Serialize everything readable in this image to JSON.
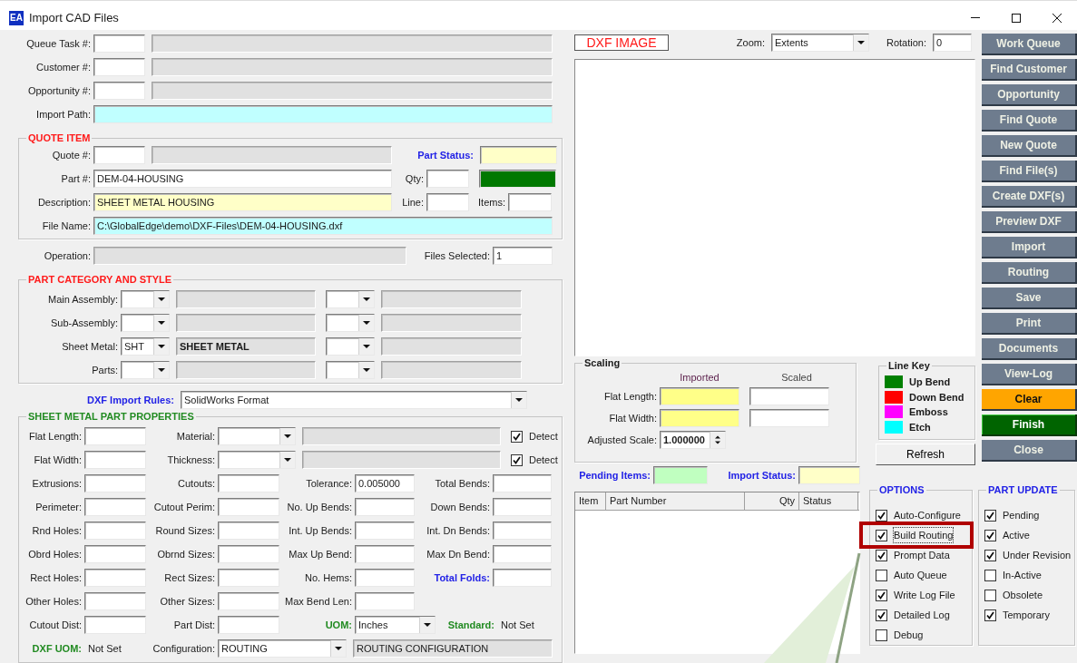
{
  "window": {
    "title": "Import CAD Files",
    "app_badge": "EA"
  },
  "lookups": [
    {
      "label": "Queue Task #:"
    },
    {
      "label": "Customer #:"
    },
    {
      "label": "Opportunity #:"
    }
  ],
  "import_path": {
    "label": "Import Path:"
  },
  "quote_item": {
    "title": "QUOTE ITEM",
    "quote_label": "Quote #:",
    "part_status_label": "Part Status:",
    "part_label": "Part #:",
    "part_number": "DEM-04-HOUSING",
    "qty_label": "Qty:",
    "description_label": "Description:",
    "description": "SHEET METAL HOUSING",
    "line_label": "Line:",
    "items_label": "Items:",
    "file_name_label": "File Name:",
    "file_name": "C:\\GlobalEdge\\demo\\DXF-Files\\DEM-04-HOUSING.dxf"
  },
  "operation": {
    "label": "Operation:",
    "files_selected_label": "Files Selected:",
    "files_selected": "1"
  },
  "part_category": {
    "title": "PART CATEGORY AND STYLE",
    "rows": [
      {
        "label": "Main Assembly:"
      },
      {
        "label": "Sub-Assembly:"
      },
      {
        "label": "Sheet Metal:",
        "code": "SHT",
        "description": "SHEET METAL"
      },
      {
        "label": "Parts:"
      }
    ]
  },
  "import_rules": {
    "label": "DXF Import Rules:",
    "value": "SolidWorks Format"
  },
  "sheet_metal": {
    "title": "SHEET METAL PART PROPERTIES",
    "rows": [
      [
        {
          "kind": "label",
          "text": "Flat Length:"
        },
        {
          "kind": "text"
        },
        {
          "kind": "label",
          "text": "Material:"
        },
        {
          "kind": "combo"
        },
        {
          "kind": "readonly"
        },
        {
          "kind": "check",
          "text": "Detect",
          "checked": true
        }
      ],
      [
        {
          "kind": "label",
          "text": "Flat Width:"
        },
        {
          "kind": "text"
        },
        {
          "kind": "label",
          "text": "Thickness:"
        },
        {
          "kind": "combo"
        },
        {
          "kind": "readonly"
        },
        {
          "kind": "check",
          "text": "Detect",
          "checked": true
        }
      ],
      [
        {
          "kind": "label",
          "text": "Extrusions:"
        },
        {
          "kind": "text"
        },
        {
          "kind": "label",
          "text": "Cutouts:"
        },
        {
          "kind": "text"
        },
        {
          "kind": "label",
          "text": "Tolerance:"
        },
        {
          "kind": "text",
          "value": "0.005000"
        },
        {
          "kind": "label",
          "text": "Total Bends:"
        },
        {
          "kind": "text"
        }
      ],
      [
        {
          "kind": "label",
          "text": "Perimeter:"
        },
        {
          "kind": "text"
        },
        {
          "kind": "label",
          "text": "Cutout Perim:"
        },
        {
          "kind": "text"
        },
        {
          "kind": "label",
          "text": "No. Up Bends:"
        },
        {
          "kind": "text"
        },
        {
          "kind": "label",
          "text": "Down Bends:"
        },
        {
          "kind": "text"
        }
      ],
      [
        {
          "kind": "label",
          "text": "Rnd Holes:"
        },
        {
          "kind": "text"
        },
        {
          "kind": "label",
          "text": "Round Sizes:"
        },
        {
          "kind": "text"
        },
        {
          "kind": "label",
          "text": "Int. Up Bends:"
        },
        {
          "kind": "text"
        },
        {
          "kind": "label",
          "text": "Int. Dn Bends:"
        },
        {
          "kind": "text"
        }
      ],
      [
        {
          "kind": "label",
          "text": "Obrd Holes:"
        },
        {
          "kind": "text"
        },
        {
          "kind": "label",
          "text": "Obrnd Sizes:"
        },
        {
          "kind": "text"
        },
        {
          "kind": "label",
          "text": "Max Up Bend:"
        },
        {
          "kind": "text"
        },
        {
          "kind": "label",
          "text": "Max Dn Bend:"
        },
        {
          "kind": "text"
        }
      ],
      [
        {
          "kind": "label",
          "text": "Rect Holes:"
        },
        {
          "kind": "text"
        },
        {
          "kind": "label",
          "text": "Rect Sizes:"
        },
        {
          "kind": "text"
        },
        {
          "kind": "label",
          "text": "No. Hems:"
        },
        {
          "kind": "text"
        },
        {
          "kind": "label",
          "text": "Total Folds:",
          "color": "#2222e6"
        },
        {
          "kind": "text"
        }
      ],
      [
        {
          "kind": "label",
          "text": "Other Holes:"
        },
        {
          "kind": "text"
        },
        {
          "kind": "label",
          "text": "Other Sizes:"
        },
        {
          "kind": "text"
        },
        {
          "kind": "label",
          "text": "Max Bend Len:"
        },
        {
          "kind": "text"
        }
      ],
      [
        {
          "kind": "label",
          "text": "Cutout Dist:"
        },
        {
          "kind": "text"
        },
        {
          "kind": "label",
          "text": "Part Dist:"
        },
        {
          "kind": "text"
        },
        {
          "kind": "label",
          "text": "UOM:",
          "color": "#228b22"
        },
        {
          "kind": "combo",
          "value": "Inches"
        },
        {
          "kind": "label",
          "text": "Standard:",
          "color": "#228b22"
        },
        {
          "kind": "value",
          "text": "Not Set"
        }
      ]
    ],
    "bottom_row": {
      "dxf_uom_label": "DXF UOM:",
      "dxf_uom": "Not Set",
      "configuration_label": "Configuration:",
      "configuration": "ROUTING",
      "configuration_description": "ROUTING CONFIGURATION"
    }
  },
  "dxf_view": {
    "title": "DXF IMAGE",
    "zoom_label": "Zoom:",
    "zoom": "Extents",
    "rotation_label": "Rotation:",
    "rotation": "0"
  },
  "scaling": {
    "title": "Scaling",
    "imported_header": "Imported",
    "scaled_header": "Scaled",
    "flat_length_label": "Flat Length:",
    "flat_width_label": "Flat Width:",
    "adjusted_scale_label": "Adjusted Scale:",
    "adjusted_scale": "1.000000"
  },
  "line_key": {
    "title": "Line Key",
    "items": [
      {
        "label": "Up Bend",
        "color": "#008000"
      },
      {
        "label": "Down Bend",
        "color": "#ff0000"
      },
      {
        "label": "Emboss",
        "color": "#ff00ff"
      },
      {
        "label": "Etch",
        "color": "#00ffff"
      }
    ]
  },
  "refresh_button": "Refresh",
  "pending_items_label": "Pending Items:",
  "import_status_label": "Import Status:",
  "items_table": {
    "columns": [
      "Item",
      "Part Number",
      "Qty",
      "Status"
    ]
  },
  "options": {
    "title": "OPTIONS",
    "items": [
      {
        "label": "Auto-Configure",
        "checked": true,
        "focused": false,
        "highlighted": false
      },
      {
        "label": "Build Routing",
        "checked": true,
        "focused": true,
        "highlighted": true
      },
      {
        "label": "Prompt Data",
        "checked": true,
        "focused": false,
        "highlighted": false
      },
      {
        "label": "Auto Queue",
        "checked": false,
        "focused": false,
        "highlighted": false
      },
      {
        "label": "Write Log File",
        "checked": true,
        "focused": false,
        "highlighted": false
      },
      {
        "label": "Detailed Log",
        "checked": true,
        "focused": false,
        "highlighted": false
      },
      {
        "label": "Debug",
        "checked": false,
        "focused": false,
        "highlighted": false
      }
    ]
  },
  "part_update": {
    "title": "PART UPDATE",
    "items": [
      {
        "label": "Pending",
        "checked": true
      },
      {
        "label": "Active",
        "checked": true
      },
      {
        "label": "Under Revision",
        "checked": true
      },
      {
        "label": "In-Active",
        "checked": false
      },
      {
        "label": "Obsolete",
        "checked": false
      },
      {
        "label": "Temporary",
        "checked": true
      }
    ]
  },
  "buttons": [
    {
      "label": "Work Queue",
      "kind": "standard"
    },
    {
      "label": "Find Customer",
      "kind": "standard"
    },
    {
      "label": "Opportunity",
      "kind": "standard"
    },
    {
      "label": "Find Quote",
      "kind": "standard"
    },
    {
      "label": "New Quote",
      "kind": "standard"
    },
    {
      "label": "Find File(s)",
      "kind": "standard"
    },
    {
      "label": "Create DXF(s)",
      "kind": "standard"
    },
    {
      "label": "Preview DXF",
      "kind": "standard"
    },
    {
      "label": "Import",
      "kind": "standard"
    },
    {
      "label": "Routing",
      "kind": "standard"
    },
    {
      "label": "Save",
      "kind": "standard"
    },
    {
      "label": "Print",
      "kind": "standard"
    },
    {
      "label": "Documents",
      "kind": "standard"
    },
    {
      "label": "View-Log",
      "kind": "standard"
    },
    {
      "label": "Clear",
      "kind": "warning"
    },
    {
      "label": "Finish",
      "kind": "confirm"
    },
    {
      "label": "Close",
      "kind": "standard"
    }
  ]
}
